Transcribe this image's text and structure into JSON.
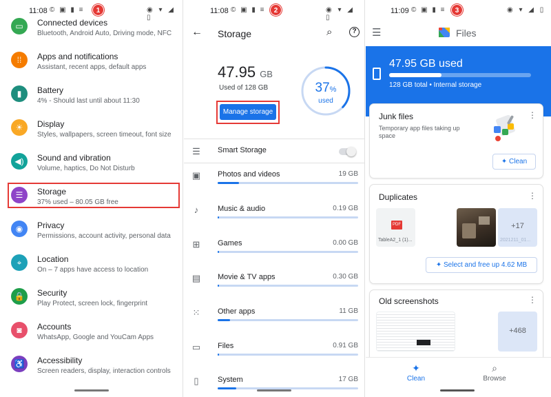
{
  "screen1": {
    "status": {
      "time": "11:08",
      "left_icons": "© ▣ ▮ ≡",
      "right_icons": "◉ ▾ ◢ ▯",
      "badge": "1"
    },
    "items": [
      {
        "title": "Connected devices",
        "subtitle": "Bluetooth, Android Auto, Driving mode, NFC",
        "icon": "devices-icon",
        "glyph": "▭",
        "color": "#34a853"
      },
      {
        "title": "Apps and notifications",
        "subtitle": "Assistant, recent apps, default apps",
        "icon": "apps-icon",
        "glyph": "⁞⁞",
        "color": "#f57c00"
      },
      {
        "title": "Battery",
        "subtitle": "4% - Should last until about 11:30",
        "icon": "battery-icon",
        "glyph": "▮",
        "color": "#1e8e7e"
      },
      {
        "title": "Display",
        "subtitle": "Styles, wallpapers, screen timeout, font size",
        "icon": "display-icon",
        "glyph": "☀",
        "color": "#f9a825"
      },
      {
        "title": "Sound and vibration",
        "subtitle": "Volume, haptics, Do Not Disturb",
        "icon": "sound-icon",
        "glyph": "◀)",
        "color": "#12a39a"
      },
      {
        "title": "Storage",
        "subtitle": "37% used – 80.05 GB free",
        "icon": "storage-icon",
        "glyph": "☰",
        "color": "#8e44c8"
      },
      {
        "title": "Privacy",
        "subtitle": "Permissions, account activity, personal data",
        "icon": "privacy-icon",
        "glyph": "◉",
        "color": "#4285f4"
      },
      {
        "title": "Location",
        "subtitle": "On – 7 apps have access to location",
        "icon": "location-icon",
        "glyph": "⌖",
        "color": "#1da1b8"
      },
      {
        "title": "Security",
        "subtitle": "Play Protect, screen lock, fingerprint",
        "icon": "security-icon",
        "glyph": "🔒",
        "color": "#1e9e4a"
      },
      {
        "title": "Accounts",
        "subtitle": "WhatsApp, Google and YouCam Apps",
        "icon": "accounts-icon",
        "glyph": "◙",
        "color": "#e8506b"
      },
      {
        "title": "Accessibility",
        "subtitle": "Screen readers, display, interaction controls",
        "icon": "accessibility-icon",
        "glyph": "♿",
        "color": "#7b3fbf"
      }
    ]
  },
  "screen2": {
    "status": {
      "time": "11:08",
      "left_icons": "© ▣ ▮ ≡",
      "right_icons": "◉ ▾ ◢ ▯",
      "badge": "2"
    },
    "title": "Storage",
    "used_value": "47.95",
    "used_unit": "GB",
    "used_of": "Used of 128 GB",
    "manage_button": "Manage storage",
    "ring_percent": "37",
    "ring_percent_sign": "%",
    "ring_label": "used",
    "ring_fraction": 0.37,
    "smart_storage": "Smart Storage",
    "categories": [
      {
        "label": "Photos and videos",
        "value": "19 GB",
        "fraction": 0.15,
        "icon": "photos-icon",
        "glyph": "▣"
      },
      {
        "label": "Music & audio",
        "value": "0.19 GB",
        "fraction": 0.0,
        "icon": "music-icon",
        "glyph": "♪"
      },
      {
        "label": "Games",
        "value": "0.00 GB",
        "fraction": 0.0,
        "icon": "games-icon",
        "glyph": "⊞"
      },
      {
        "label": "Movie & TV apps",
        "value": "0.30 GB",
        "fraction": 0.0,
        "icon": "movie-icon",
        "glyph": "▤"
      },
      {
        "label": "Other apps",
        "value": "11 GB",
        "fraction": 0.09,
        "icon": "other-apps-icon",
        "glyph": "⁙"
      },
      {
        "label": "Files",
        "value": "0.91 GB",
        "fraction": 0.01,
        "icon": "files-folder-icon",
        "glyph": "▭"
      },
      {
        "label": "System",
        "value": "17 GB",
        "fraction": 0.13,
        "icon": "system-icon",
        "glyph": "▯"
      }
    ]
  },
  "screen3": {
    "status": {
      "time": "11:09",
      "left_icons": "© ▣ ▮ ≡",
      "right_icons": "◉ ▾ ◢ ▯",
      "badge": "3"
    },
    "app_title": "Files",
    "used": "47.95 GB used",
    "used_fraction": 0.37,
    "total": "128 GB total • Internal storage",
    "junk": {
      "title": "Junk files",
      "subtitle": "Temporary app files taking up space",
      "button": "Clean"
    },
    "duplicates": {
      "title": "Duplicates",
      "file_label": "TableA2_1 (1)...",
      "file_badge": "PDF",
      "more_count": "+17",
      "more_caption": "2021211_01...",
      "button": "Select and free up 4.62 MB"
    },
    "screenshots": {
      "title": "Old screenshots",
      "more_count": "+468"
    },
    "nav": [
      {
        "label": "Clean",
        "glyph": "✦",
        "active": true
      },
      {
        "label": "Browse",
        "glyph": "⌕",
        "active": false
      }
    ],
    "accent": "#1a73e8"
  }
}
